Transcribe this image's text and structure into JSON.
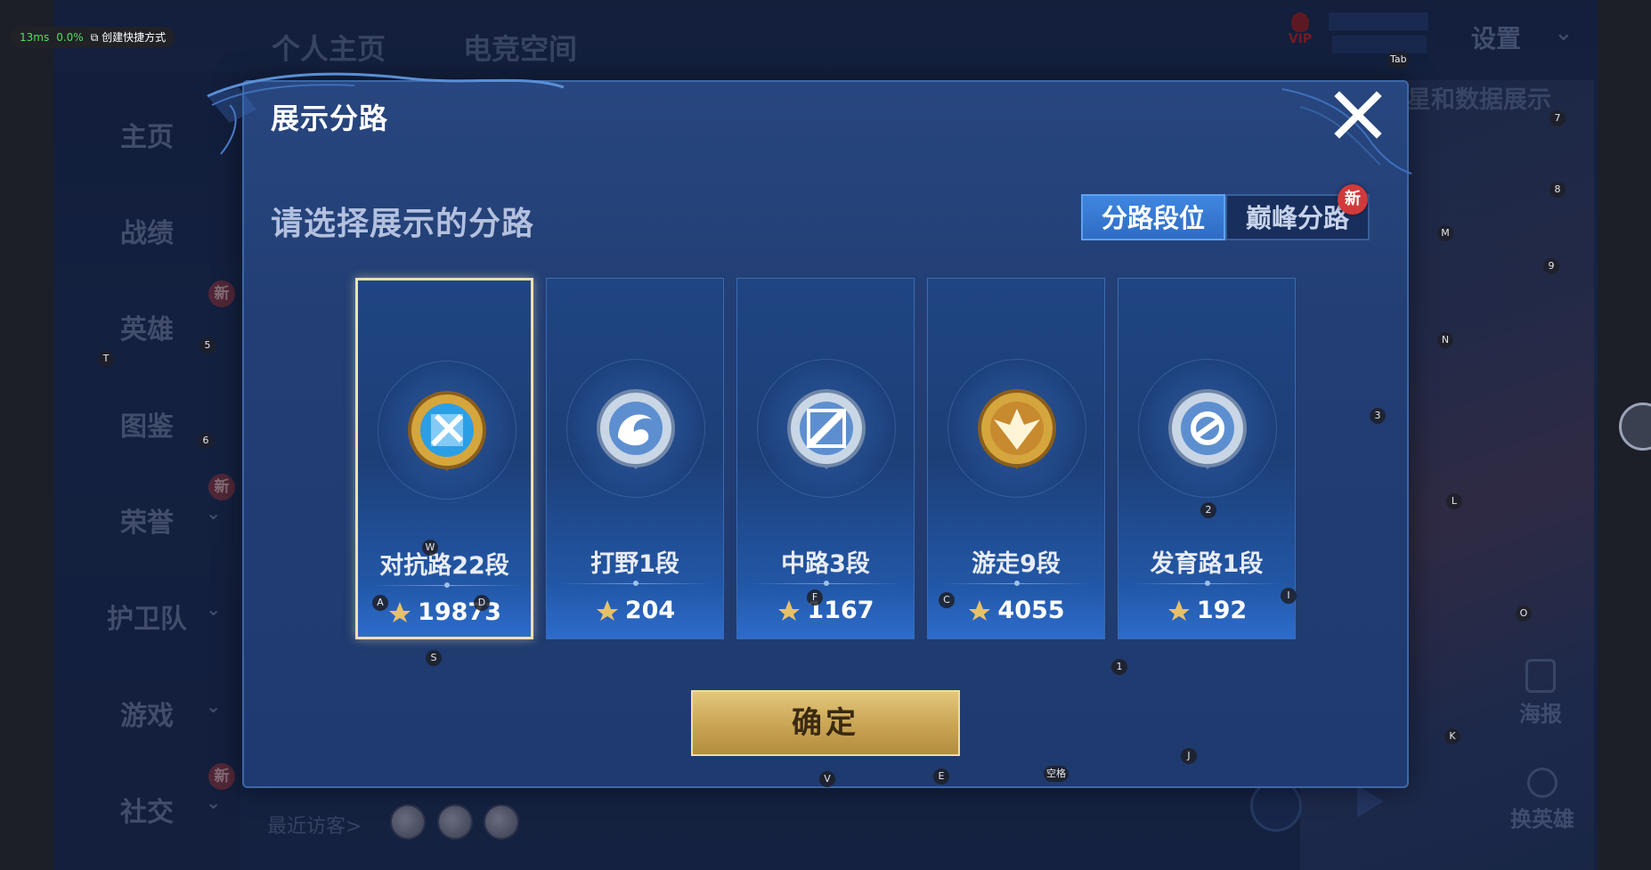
{
  "perf": {
    "latency": "13ms",
    "loss": "0.0%",
    "shortcut": "创建快捷方式"
  },
  "top_tabs": [
    "个人主页",
    "电竞空间"
  ],
  "header_right": {
    "vip": "VIP",
    "settings": "设置",
    "data_show": "星和数据展示"
  },
  "side_nav": [
    {
      "label": "主页",
      "has_new": false,
      "has_chevron": false
    },
    {
      "label": "战绩",
      "has_new": false,
      "has_chevron": false
    },
    {
      "label": "英雄",
      "has_new": true,
      "has_chevron": false
    },
    {
      "label": "图鉴",
      "has_new": false,
      "has_chevron": false
    },
    {
      "label": "荣誉",
      "has_new": true,
      "has_chevron": true
    },
    {
      "label": "护卫队",
      "has_new": false,
      "has_chevron": true
    },
    {
      "label": "游戏",
      "has_new": false,
      "has_chevron": true
    },
    {
      "label": "社交",
      "has_new": true,
      "has_chevron": true
    }
  ],
  "new_badge": "新",
  "recent_visitors": "最近访客>",
  "float_buttons": {
    "poster": "海报",
    "switch_hero": "换英雄"
  },
  "dialog": {
    "title": "展示分路",
    "prompt": "请选择展示的分路",
    "segments": {
      "active": "分路段位",
      "inactive": "巅峰分路",
      "new_badge": "新"
    },
    "lanes": [
      {
        "name": "对抗路22段",
        "score": "19873",
        "selected": true,
        "emblem": "clash-lane-gold-emblem"
      },
      {
        "name": "打野1段",
        "score": "204",
        "selected": false,
        "emblem": "jungle-dragon-emblem"
      },
      {
        "name": "中路3段",
        "score": "1167",
        "selected": false,
        "emblem": "mid-lane-emblem"
      },
      {
        "name": "游走9段",
        "score": "4055",
        "selected": false,
        "emblem": "roam-gold-emblem"
      },
      {
        "name": "发育路1段",
        "score": "192",
        "selected": false,
        "emblem": "farm-lane-emblem"
      }
    ],
    "confirm": "确定"
  },
  "key_hints": [
    "Tab",
    "7",
    "8",
    "M",
    "9",
    "N",
    "3",
    "L",
    "2",
    "O",
    "I",
    "1",
    "K",
    "J",
    "空格",
    "E",
    "V",
    "S",
    "A",
    "W",
    "D",
    "F",
    "C",
    "5",
    "T",
    "6"
  ]
}
